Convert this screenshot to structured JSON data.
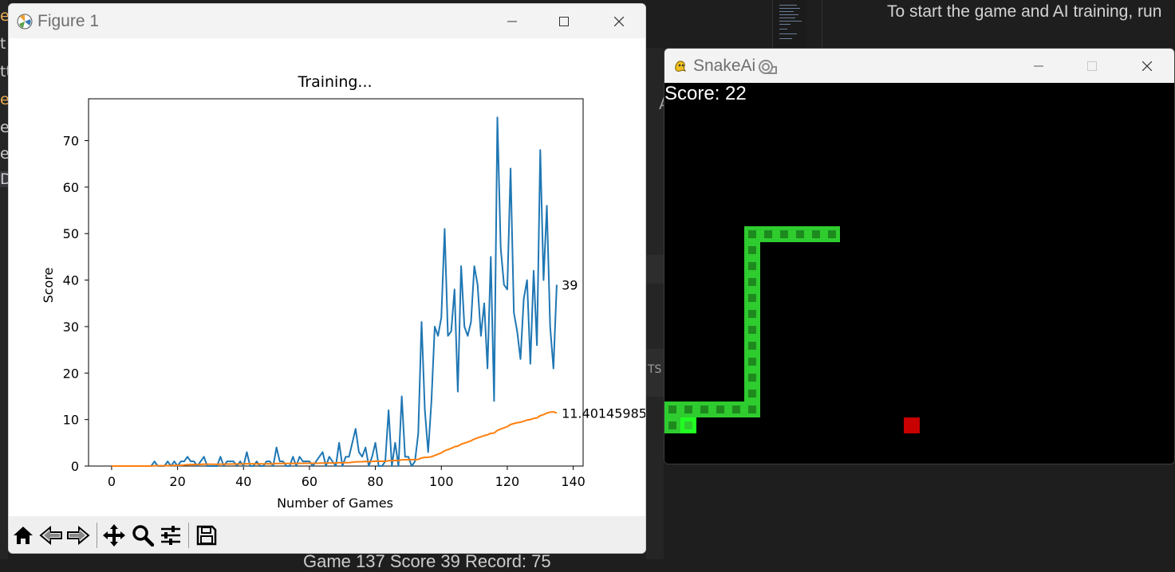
{
  "background": {
    "readme_text": "To start the game and AI training, run",
    "left_fragments": [
      "e",
      "t",
      "tt",
      "e",
      "er",
      "e",
      "D"
    ],
    "mid_fragments": [
      "A",
      "TS"
    ],
    "bottom_fragment": "Game 137  Score 39  Record: 75"
  },
  "figure_window": {
    "title": "Figure 1",
    "controls": [
      "minimize",
      "maximize",
      "close"
    ],
    "toolbar": {
      "items": [
        {
          "name": "home",
          "icon": "home-icon"
        },
        {
          "name": "back",
          "icon": "arrow-left-icon"
        },
        {
          "name": "forward",
          "icon": "arrow-right-icon"
        },
        {
          "name": "pan",
          "icon": "move-icon"
        },
        {
          "name": "zoom",
          "icon": "zoom-icon"
        },
        {
          "name": "configure",
          "icon": "sliders-icon"
        },
        {
          "name": "save",
          "icon": "save-icon"
        }
      ]
    }
  },
  "chart_data": {
    "type": "line",
    "title": "Training...",
    "xlabel": "Number of Games",
    "ylabel": "Score",
    "xlim": [
      -7,
      143
    ],
    "ylim": [
      0,
      79
    ],
    "xticks": [
      0,
      20,
      40,
      60,
      80,
      100,
      120,
      140
    ],
    "yticks": [
      0,
      10,
      20,
      30,
      40,
      50,
      60,
      70
    ],
    "grid": false,
    "series": [
      {
        "color": "#1f77b4",
        "values": [
          0,
          0,
          0,
          0,
          0,
          0,
          0,
          0,
          0,
          0,
          0,
          0,
          0,
          1,
          0,
          0,
          0,
          1,
          0,
          1,
          0,
          1,
          1,
          2,
          1,
          1,
          0,
          1,
          2,
          0,
          0,
          0,
          0,
          2,
          0,
          1,
          1,
          1,
          0,
          1,
          0,
          3,
          0,
          0,
          1,
          0,
          0,
          1,
          1,
          0,
          4,
          1,
          1,
          0,
          0,
          2,
          0,
          2,
          1,
          1,
          1,
          0,
          1,
          2,
          3,
          0,
          2,
          1,
          0,
          5,
          0,
          2,
          2,
          5,
          8,
          3,
          2,
          4,
          0,
          2,
          5,
          0,
          0,
          1,
          12,
          0,
          5,
          0,
          15,
          2,
          2,
          0,
          1,
          7,
          31,
          12,
          3,
          14,
          30,
          28,
          32,
          51,
          28,
          29,
          38,
          16,
          43,
          30,
          28,
          31,
          43,
          39,
          28,
          35,
          21,
          45,
          14,
          75,
          47,
          39,
          38,
          64,
          33,
          29,
          23,
          36,
          40,
          22,
          42,
          26,
          68,
          40,
          56,
          30,
          21,
          39
        ]
      },
      {
        "color": "#ff7f0e",
        "values": [
          0,
          0,
          0,
          0,
          0,
          0,
          0,
          0,
          0,
          0,
          0,
          0,
          0,
          0.07,
          0.07,
          0.07,
          0.06,
          0.11,
          0.11,
          0.15,
          0.14,
          0.18,
          0.22,
          0.29,
          0.32,
          0.35,
          0.33,
          0.36,
          0.41,
          0.4,
          0.39,
          0.38,
          0.36,
          0.41,
          0.4,
          0.42,
          0.43,
          0.45,
          0.44,
          0.45,
          0.44,
          0.5,
          0.49,
          0.48,
          0.49,
          0.48,
          0.47,
          0.48,
          0.49,
          0.48,
          0.55,
          0.56,
          0.57,
          0.56,
          0.55,
          0.57,
          0.56,
          0.58,
          0.59,
          0.6,
          0.61,
          0.6,
          0.6,
          0.62,
          0.65,
          0.64,
          0.66,
          0.67,
          0.66,
          0.72,
          0.71,
          0.73,
          0.75,
          0.81,
          0.9,
          0.93,
          0.94,
          0.98,
          0.97,
          0.99,
          1.04,
          1.03,
          1.02,
          1.02,
          1.16,
          1.15,
          1.19,
          1.18,
          1.34,
          1.35,
          1.36,
          1.36,
          1.36,
          1.43,
          1.74,
          1.87,
          1.88,
          2.0,
          2.28,
          2.55,
          2.83,
          3.29,
          3.54,
          3.81,
          4.15,
          4.28,
          4.69,
          4.92,
          5.17,
          5.44,
          5.8,
          6.06,
          6.29,
          6.56,
          6.71,
          7.04,
          7.09,
          7.66,
          7.97,
          8.22,
          8.48,
          8.93,
          9.15,
          9.32,
          9.43,
          9.65,
          9.89,
          10.0,
          10.25,
          10.36,
          10.84,
          11.06,
          11.41,
          11.59,
          11.66,
          11.4
        ]
      }
    ],
    "annotations": [
      {
        "text": "39",
        "series": 0,
        "x": 136,
        "y": 39
      },
      {
        "text": "11.40145985",
        "series": 1,
        "x": 136,
        "y": 11.40145985
      }
    ]
  },
  "snake_window": {
    "title": "SnakeAi",
    "score_text": "Score: 22",
    "grid_cell": 20,
    "body_color": "#2ecc2e",
    "inner_color": "#1e8a1e",
    "head_color": "#22ff22",
    "food_color": "#c80000",
    "snake": [
      [
        1,
        21
      ],
      [
        0,
        21
      ],
      [
        0,
        20
      ],
      [
        1,
        20
      ],
      [
        2,
        20
      ],
      [
        3,
        20
      ],
      [
        4,
        20
      ],
      [
        5,
        20
      ],
      [
        5,
        19
      ],
      [
        5,
        18
      ],
      [
        5,
        17
      ],
      [
        5,
        16
      ],
      [
        5,
        15
      ],
      [
        5,
        14
      ],
      [
        5,
        13
      ],
      [
        5,
        12
      ],
      [
        5,
        11
      ],
      [
        5,
        10
      ],
      [
        5,
        9
      ],
      [
        6,
        9
      ],
      [
        7,
        9
      ],
      [
        8,
        9
      ],
      [
        9,
        9
      ],
      [
        10,
        9
      ]
    ],
    "food": [
      15,
      21
    ]
  }
}
